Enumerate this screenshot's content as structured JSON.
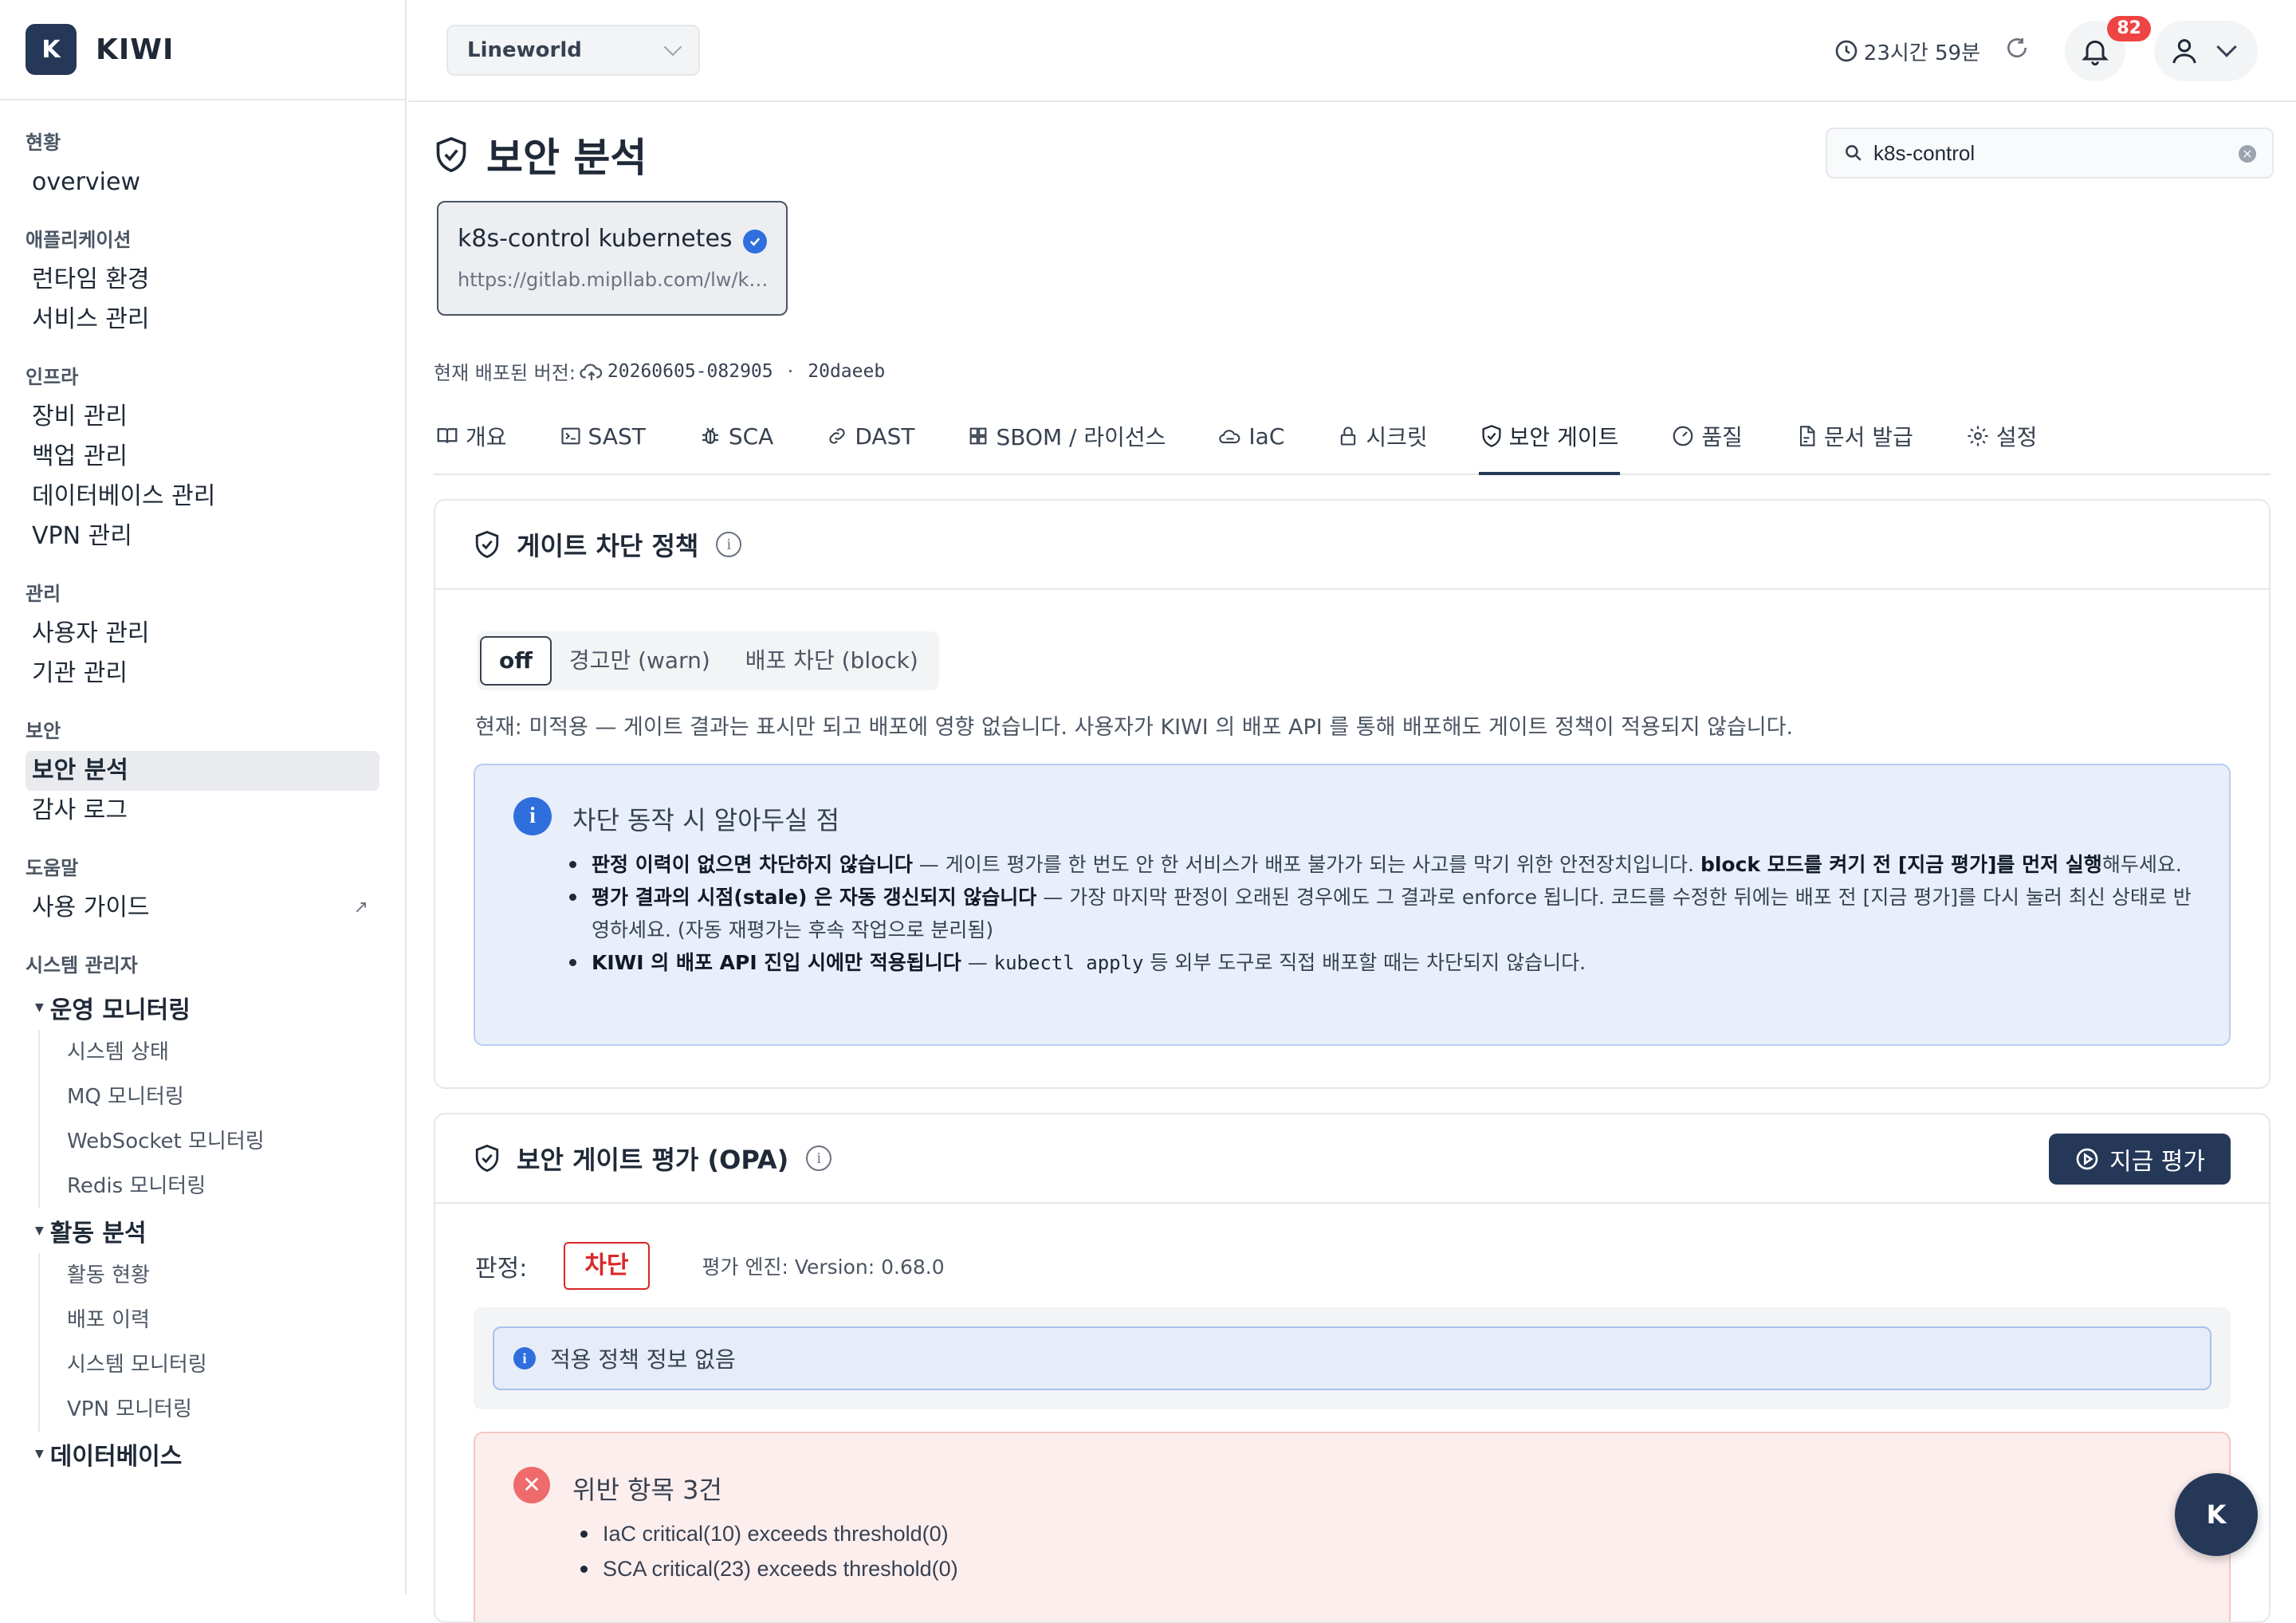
{
  "app": {
    "logo_letter": "K",
    "name": "KIWI"
  },
  "sidebar": {
    "groups": [
      {
        "title": "현황",
        "items": [
          {
            "label": "overview"
          }
        ]
      },
      {
        "title": "애플리케이션",
        "items": [
          {
            "label": "런타임 환경"
          },
          {
            "label": "서비스 관리"
          }
        ]
      },
      {
        "title": "인프라",
        "items": [
          {
            "label": "장비 관리"
          },
          {
            "label": "백업 관리"
          },
          {
            "label": "데이터베이스 관리"
          },
          {
            "label": "VPN 관리"
          }
        ]
      },
      {
        "title": "관리",
        "items": [
          {
            "label": "사용자 관리"
          },
          {
            "label": "기관 관리"
          }
        ]
      },
      {
        "title": "보안",
        "items": [
          {
            "label": "보안 분석",
            "active": true
          },
          {
            "label": "감사 로그"
          }
        ]
      },
      {
        "title": "도움말",
        "items": [
          {
            "label": "사용 가이드",
            "external_icon": "↗"
          }
        ]
      }
    ],
    "admin": {
      "title": "시스템 관리자",
      "subgroups": [
        {
          "title": "운영 모니터링",
          "items": [
            "시스템 상태",
            "MQ 모니터링",
            "WebSocket 모니터링",
            "Redis 모니터링"
          ]
        },
        {
          "title": "활동 분석",
          "items": [
            "활동 현황",
            "배포 이력",
            "시스템 모니터링",
            "VPN 모니터링"
          ]
        },
        {
          "title": "데이터베이스",
          "items": []
        }
      ]
    }
  },
  "topbar": {
    "project": "Lineworld",
    "session_time": "23시간 59분",
    "notification_count": "82"
  },
  "page": {
    "title": "보안 분석",
    "search_value": "k8s-control"
  },
  "target": {
    "name": "k8s-control kubernetes",
    "url": "https://gitlab.mipllab.com/lw/kiwi/..."
  },
  "version": {
    "label": "현재 배포된 버전:",
    "tag": "20260605-082905",
    "commit": "20daeeb"
  },
  "tabs": [
    {
      "label": "개요",
      "icon": "book-icon"
    },
    {
      "label": "SAST",
      "icon": "terminal-icon"
    },
    {
      "label": "SCA",
      "icon": "bug-icon"
    },
    {
      "label": "DAST",
      "icon": "link-icon"
    },
    {
      "label": "SBOM / 라이선스",
      "icon": "grid-icon"
    },
    {
      "label": "IaC",
      "icon": "cloud-icon"
    },
    {
      "label": "시크릿",
      "icon": "lock-icon"
    },
    {
      "label": "보안 게이트",
      "icon": "shield-icon",
      "active": true
    },
    {
      "label": "품질",
      "icon": "gauge-icon"
    },
    {
      "label": "문서 발급",
      "icon": "document-icon"
    },
    {
      "label": "설정",
      "icon": "gear-icon"
    }
  ],
  "gate_policy": {
    "title": "게이트 차단 정책",
    "modes": [
      {
        "label": "off",
        "active": true
      },
      {
        "label": "경고만 (warn)"
      },
      {
        "label": "배포 차단 (block)"
      }
    ],
    "status": "현재: 미적용 — 게이트 결과는 표시만 되고 배포에 영향 없습니다. 사용자가 KIWI 의 배포 API 를 통해 배포해도 게이트 정책이 적용되지 않습니다.",
    "notice": {
      "title": "차단 동작 시 알아두실 점",
      "items": [
        {
          "bold": "판정 이력이 없으면 차단하지 않습니다",
          "text": " — 게이트 평가를 한 번도 안 한 서비스가 배포 불가가 되는 사고를 막기 위한 안전장치입니다. ",
          "bold2": "block 모드를 켜기 전 [지금 평가]를 먼저 실행",
          "text2": "해두세요."
        },
        {
          "bold": "평가 결과의 시점(stale) 은 자동 갱신되지 않습니다",
          "text": " — 가장 마지막 판정이 오래된 경우에도 그 결과로 enforce 됩니다. 코드를 수정한 뒤에는 배포 전 [지금 평가]를 다시 눌러 최신 상태로 반영하세요. (자동 재평가는 후속 작업으로 분리됨)"
        },
        {
          "bold": "KIWI 의 배포 API 진입 시에만 적용됩니다",
          "text": " — ",
          "code": "kubectl apply",
          "text2": " 등 외부 도구로 직접 배포할 때는 차단되지 않습니다."
        }
      ]
    }
  },
  "gate_eval": {
    "title": "보안 게이트 평가 (OPA)",
    "button": "지금 평가",
    "verdict_label": "판정:",
    "verdict": "차단",
    "engine": "평가 엔진: Version: 0.68.0",
    "policy_info": "적용 정책 정보 없음",
    "violations_title": "위반 항목 3건",
    "violations": [
      "IaC critical(10) exceeds threshold(0)",
      "SCA critical(23) exceeds threshold(0)"
    ]
  },
  "fab": {
    "label": "K"
  },
  "colors": {
    "brand": "#253858",
    "accent": "#2f6fdd",
    "danger": "#dc2626"
  }
}
